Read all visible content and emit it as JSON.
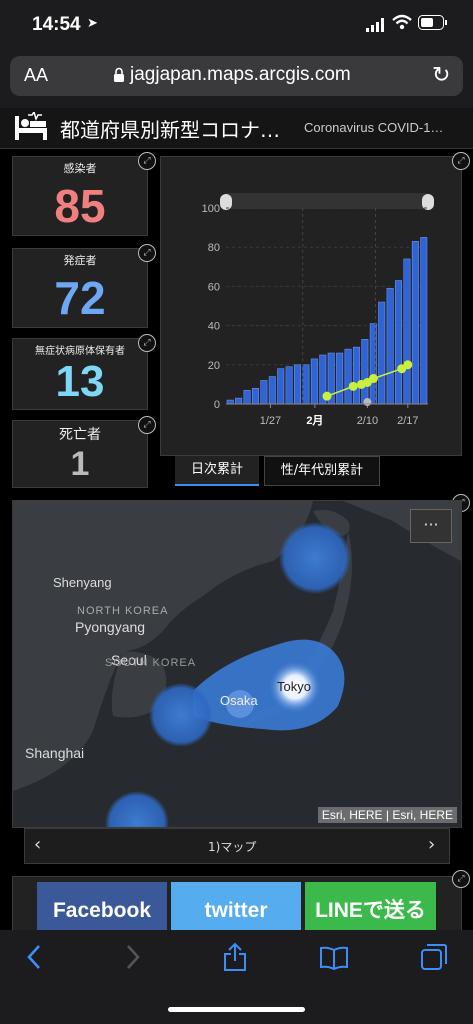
{
  "status": {
    "time": "14:54"
  },
  "browser": {
    "text_size_label": "AA",
    "url": "jagjapan.maps.arcgis.com"
  },
  "header": {
    "title": "都道府県別新型コロナ…",
    "subtitle": "Coronavirus COVID-1…"
  },
  "stats": [
    {
      "label": "感染者",
      "value": "85",
      "color": "#f08080"
    },
    {
      "label": "発症者",
      "value": "72",
      "color": "#6ea8f5"
    },
    {
      "label": "無症状病原体保有者",
      "value": "13",
      "color": "#7fd6f5"
    },
    {
      "label": "死亡者",
      "value": "1",
      "color": "#bbbbbb"
    }
  ],
  "chart_data": {
    "type": "bar",
    "ylim": [
      0,
      100
    ],
    "y_ticks": [
      "0",
      "20",
      "40",
      "60",
      "80",
      "100"
    ],
    "x_ticks": [
      "1/27",
      "2月",
      "2/10",
      "2/17"
    ],
    "cumulative_bars": [
      2,
      3,
      7,
      8,
      12,
      14,
      18,
      19,
      20,
      20,
      23,
      25,
      26,
      26,
      28,
      29,
      33,
      41,
      52,
      59,
      63,
      74,
      83,
      85
    ],
    "line_points": [
      4,
      9,
      10,
      11,
      13,
      18,
      20
    ],
    "gray_point": 1,
    "bar_color": "#2f63d6",
    "line_color": "#c8f03c"
  },
  "tabs": [
    {
      "label": "日次累計"
    },
    {
      "label": "性/年代別累計"
    }
  ],
  "map": {
    "labels": {
      "shenyang": "Shenyang",
      "north_korea": "NORTH KOREA",
      "pyongyang": "Pyongyang",
      "seoul": "Seoul",
      "south_korea": "SOUTH KOREA",
      "osaka": "Osaka",
      "tokyo": "Tokyo",
      "shanghai": "Shanghai"
    },
    "attribution": "Esri, HERE | Esri, HERE",
    "more_label": "···"
  },
  "map_nav": {
    "label": "1)マップ"
  },
  "share": [
    {
      "label": "Facebook",
      "color": "#3b5998"
    },
    {
      "label": "twitter",
      "color": "#55acee"
    },
    {
      "label": "LINEで送る",
      "color": "#3bb94a"
    }
  ]
}
